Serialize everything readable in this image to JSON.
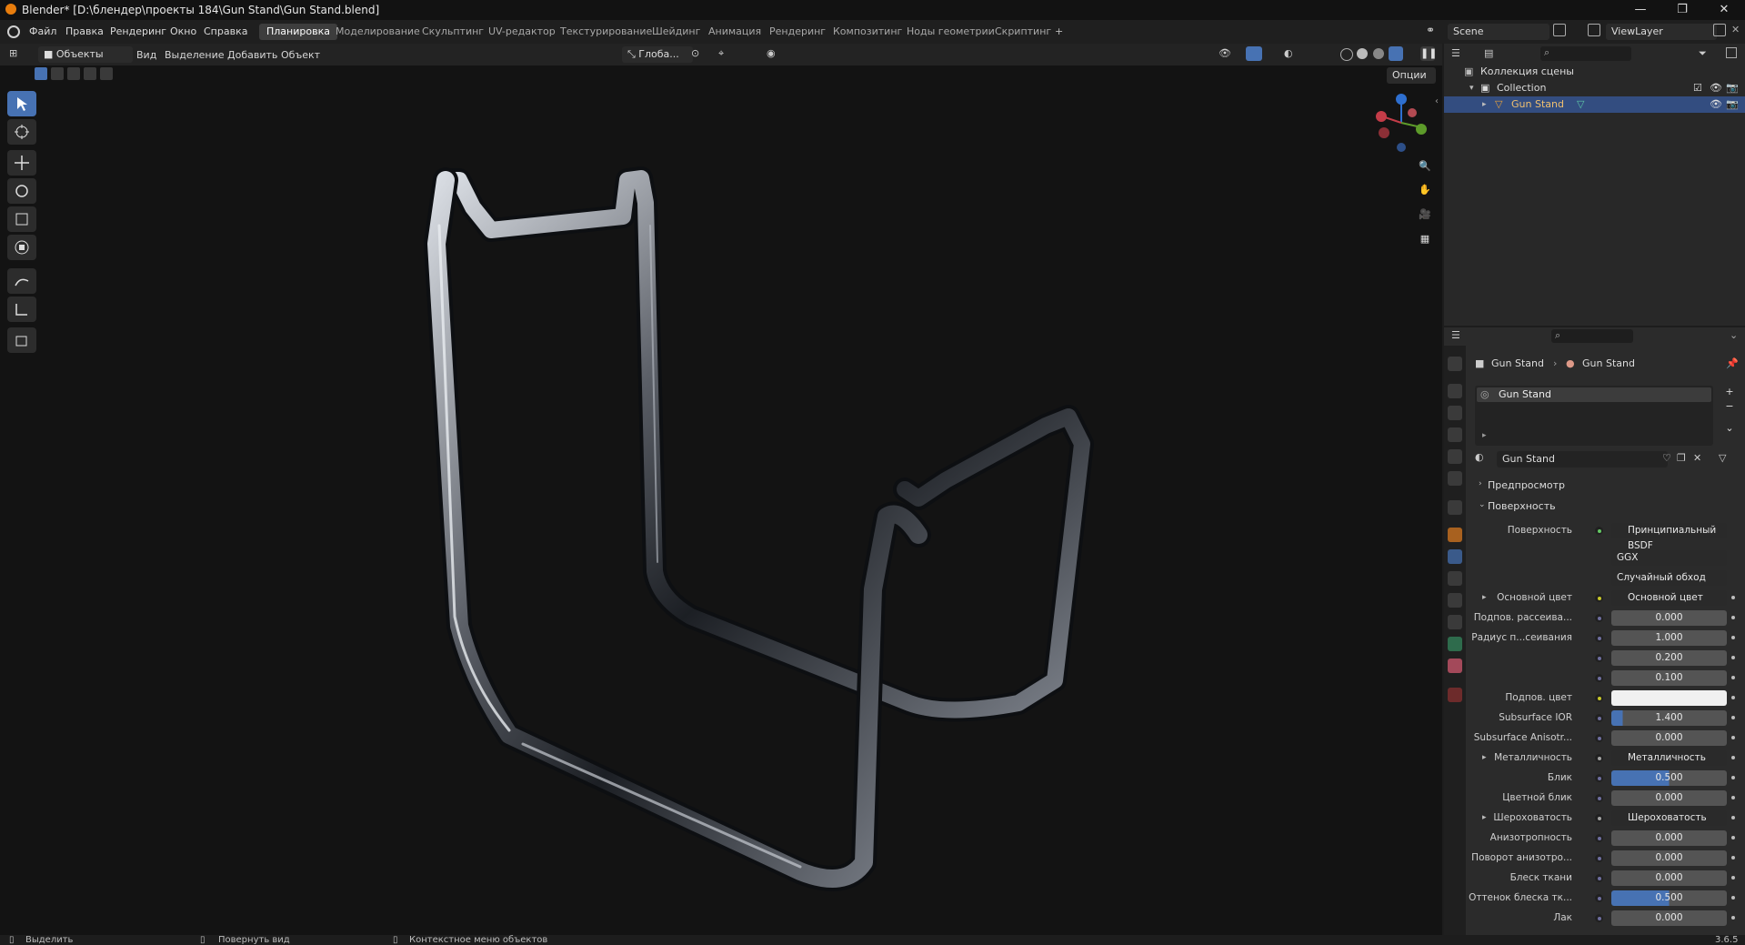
{
  "window": {
    "title": "Blender* [D:\\блендер\\проекты 184\\Gun Stand\\Gun Stand.blend]",
    "controls": [
      "—",
      "❐",
      "✕"
    ]
  },
  "menu": {
    "items": [
      "Файл",
      "Правка",
      "Рендеринг",
      "Окно",
      "Справка"
    ]
  },
  "workspaces": {
    "tabs": [
      "Планировка",
      "Моделирование",
      "Скульптинг",
      "UV-редактор",
      "Текстурирование",
      "Шейдинг",
      "Анимация",
      "Рендеринг",
      "Композитинг",
      "Ноды геометрии",
      "Скриптинг"
    ],
    "active": "Планировка",
    "add": "+"
  },
  "scene": {
    "name": "Scene",
    "view_layer": "ViewLayer"
  },
  "viewport_header": {
    "mode": "Объекты",
    "menus": [
      "Вид",
      "Выделение",
      "Добавить",
      "Объект"
    ],
    "orientation": "Глоба...",
    "options": "Опции"
  },
  "outliner": {
    "root": "Коллекция сцены",
    "collection": "Collection",
    "object": "Gun Stand"
  },
  "properties": {
    "breadcrumb": [
      "Gun Stand",
      "Gun Stand"
    ],
    "slot": "Gun Stand",
    "material": "Gun Stand",
    "sections": {
      "preview": "Предпросмотр",
      "surface": "Поверхность"
    },
    "surface_label": "Поверхность",
    "surface_value": "Принципиальный BSDF",
    "distribution": "GGX",
    "subsurface_method": "Случайный обход",
    "rows": [
      {
        "label": "Основной цвет",
        "value": "Основной цвет",
        "kind": "link",
        "expand": "▸"
      },
      {
        "label": "Подпов. рассеива...",
        "value": "0.000",
        "kind": "num"
      },
      {
        "label": "Радиус п...сеивания",
        "value": "1.000",
        "kind": "num"
      },
      {
        "label": "",
        "value": "0.200",
        "kind": "num"
      },
      {
        "label": "",
        "value": "0.100",
        "kind": "num"
      },
      {
        "label": "Подпов. цвет",
        "value": "",
        "kind": "color"
      },
      {
        "label": "Subsurface IOR",
        "value": "1.400",
        "kind": "num"
      },
      {
        "label": "Subsurface Anisotr...",
        "value": "0.000",
        "kind": "num"
      },
      {
        "label": "Металличность",
        "value": "Металличность",
        "kind": "link",
        "expand": "▸"
      },
      {
        "label": "Блик",
        "value": "0.500",
        "kind": "blue"
      },
      {
        "label": "Цветной блик",
        "value": "0.000",
        "kind": "num"
      },
      {
        "label": "Шероховатость",
        "value": "Шероховатость",
        "kind": "link",
        "expand": "▸"
      },
      {
        "label": "Анизотропность",
        "value": "0.000",
        "kind": "num"
      },
      {
        "label": "Поворот анизотро...",
        "value": "0.000",
        "kind": "num"
      },
      {
        "label": "Блеск ткани",
        "value": "0.000",
        "kind": "num"
      },
      {
        "label": "Оттенок блеска тк...",
        "value": "0.500",
        "kind": "blue"
      },
      {
        "label": "Лак",
        "value": "0.000",
        "kind": "num"
      }
    ]
  },
  "status": {
    "select": "Выделить",
    "rotate": "Повернуть вид",
    "context": "Контекстное меню объектов",
    "version": "3.6.5"
  },
  "colors": {
    "accent": "#4772b3",
    "selection": "#334d80",
    "blender_orange": "#e87d0d"
  }
}
